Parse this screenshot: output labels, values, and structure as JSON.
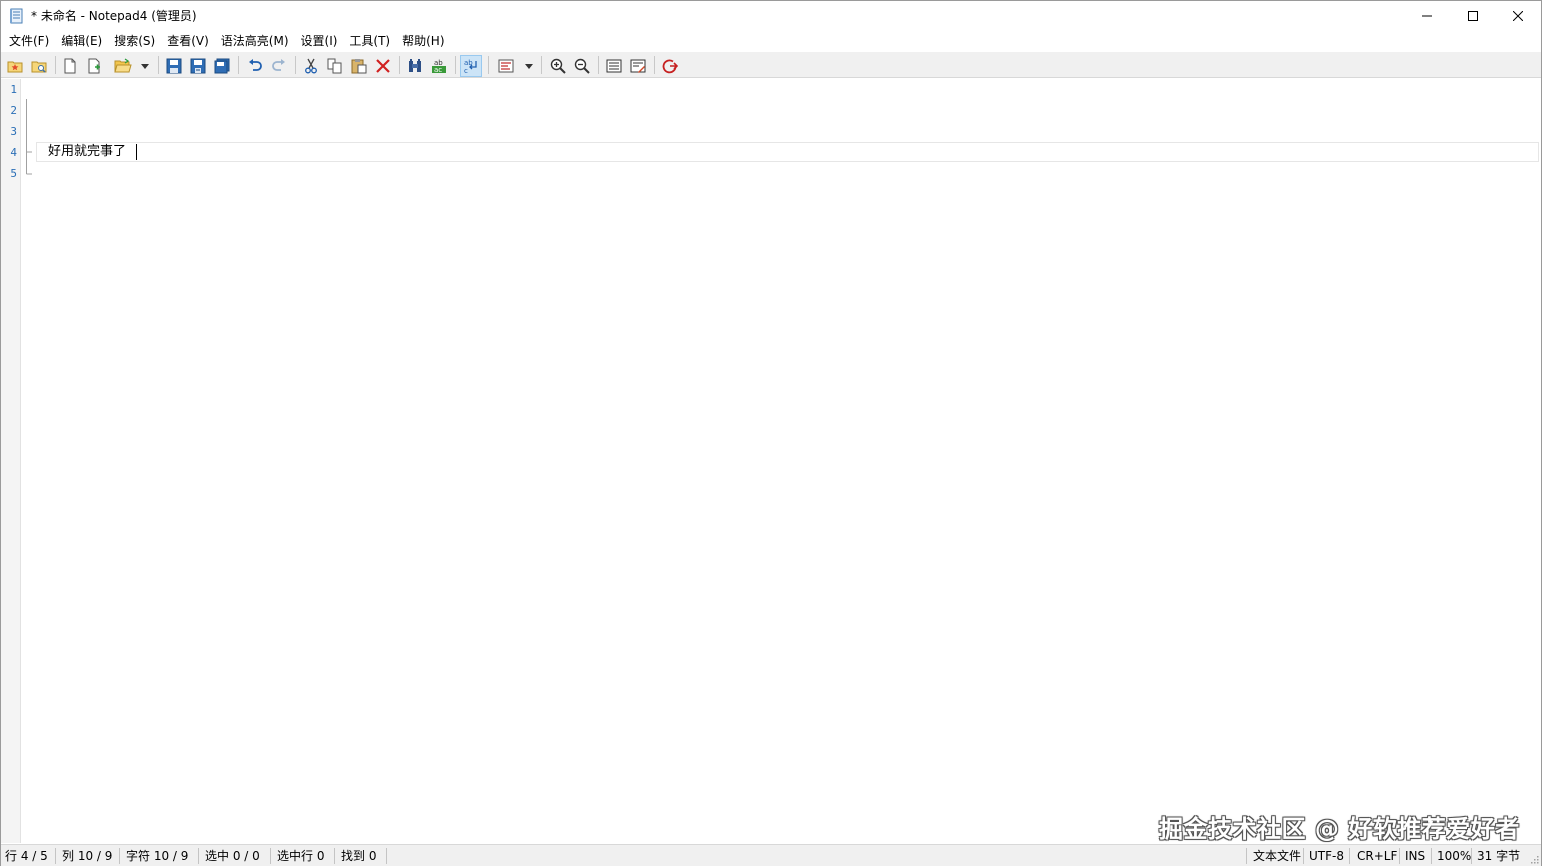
{
  "window": {
    "title": "* 未命名 - Notepad4 (管理员)"
  },
  "menu": [
    "文件(F)",
    "编辑(E)",
    "搜索(S)",
    "查看(V)",
    "语法高亮(M)",
    "设置(I)",
    "工具(T)",
    "帮助(H)"
  ],
  "toolbar": {
    "icons": [
      "favorites-icon",
      "open-folder-view-icon",
      "new-file-icon",
      "new-window-icon",
      "open-file-icon",
      "save-icon",
      "save-as-icon",
      "save-copy-icon",
      "undo-icon",
      "redo-icon",
      "cut-icon",
      "copy-icon",
      "paste-icon",
      "delete-icon",
      "find-icon",
      "replace-icon",
      "word-wrap-icon",
      "scheme-icon",
      "zoom-in-icon",
      "zoom-out-icon",
      "select-all-icon",
      "open-with-icon",
      "exit-icon"
    ],
    "word_wrap_active": true
  },
  "editor": {
    "line_numbers": [
      "1",
      "2",
      "3",
      "4",
      "5"
    ],
    "lines": [
      "",
      "",
      "",
      "好用就完事了",
      ""
    ],
    "current_line": 4
  },
  "watermark": "掘金技术社区 @ 好软推荐爱好者",
  "statusbar": {
    "line": "行 4 / 5",
    "column": "列 10 / 9",
    "char": "字符 10 / 9",
    "selected": "选中 0 / 0",
    "selected_lines": "选中行 0",
    "found": "找到 0",
    "file_type": "文本文件",
    "encoding": "UTF-8",
    "eol": "CR+LF",
    "ins_mode": "INS",
    "zoom": "100%",
    "size": "31 字节"
  },
  "colors": {
    "line_number": "#2b6fb6",
    "toolbar_bg": "#f0f0f0",
    "active_button": "#cce4f7"
  }
}
